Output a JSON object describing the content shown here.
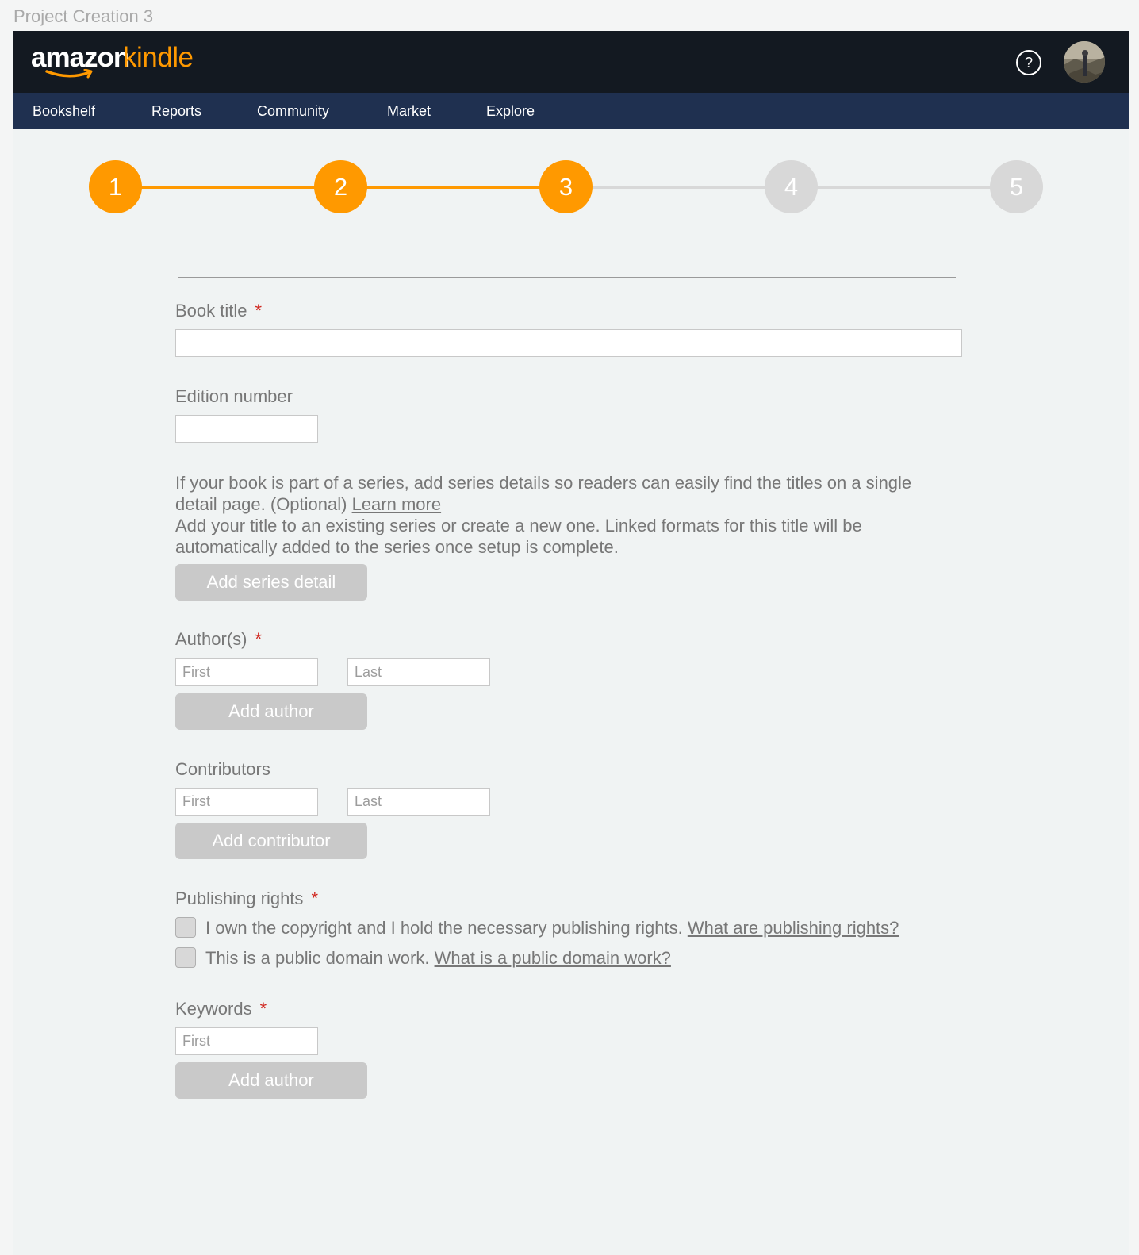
{
  "frame_title": "Project Creation 3",
  "header": {
    "logo_word1": "amazon",
    "logo_word2": "kindle",
    "help_glyph": "?",
    "help_icon": "help-circle-icon",
    "avatar_icon": "user-avatar"
  },
  "nav": {
    "items": [
      {
        "label": "Bookshelf"
      },
      {
        "label": "Reports"
      },
      {
        "label": "Community"
      },
      {
        "label": "Market"
      },
      {
        "label": "Explore"
      }
    ]
  },
  "stepper": {
    "current_step": 3,
    "steps": [
      {
        "label": "1",
        "complete": true
      },
      {
        "label": "2",
        "complete": true
      },
      {
        "label": "3",
        "complete": true
      },
      {
        "label": "4",
        "complete": false
      },
      {
        "label": "5",
        "complete": false
      }
    ]
  },
  "form": {
    "required_mark": "*",
    "book_title": {
      "label": "Book title",
      "value": "",
      "placeholder": ""
    },
    "edition_number": {
      "label": "Edition number",
      "value": "",
      "placeholder": ""
    },
    "series": {
      "text1": "If your book is part of a series, add series details so readers can easily find the titles on a single detail page. (Optional) ",
      "learn_more": "Learn more",
      "text2": "Add your title to an existing series or create a new one. Linked formats for this title will be automatically added to the series once setup is complete.",
      "button": "Add series detail"
    },
    "authors": {
      "label": "Author(s)",
      "first_placeholder": "First",
      "last_placeholder": "Last",
      "button": "Add author"
    },
    "contributors": {
      "label": "Contributors",
      "first_placeholder": "First",
      "last_placeholder": "Last",
      "button": "Add contributor"
    },
    "publishing_rights": {
      "label": "Publishing rights",
      "option1_text": "I own the copyright and I hold the necessary publishing rights. ",
      "option1_link": "What are publishing rights?",
      "option2_text": "This is a public domain work. ",
      "option2_link": "What is a public domain work?"
    },
    "keywords": {
      "label": "Keywords",
      "first_placeholder": "First",
      "button": "Add author"
    }
  },
  "colors": {
    "accent": "#ff9900",
    "topbar": "#131921",
    "navbar": "#1f3050",
    "step_inactive": "#d8d8d8",
    "button_disabled": "#c9c9c9",
    "required": "#d0241c"
  }
}
